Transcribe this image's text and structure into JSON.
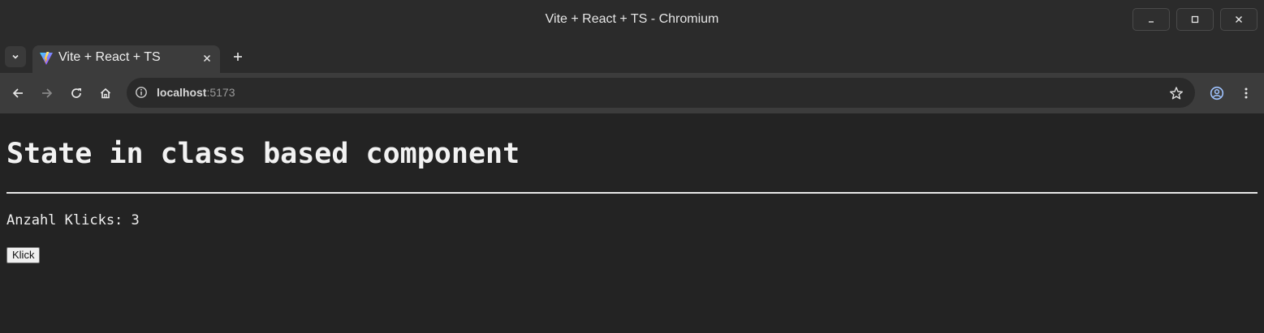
{
  "window": {
    "title": "Vite + React + TS - Chromium"
  },
  "tabs": [
    {
      "label": "Vite + React + TS",
      "favicon": "vite-logo"
    }
  ],
  "toolbar": {
    "url_host": "localhost",
    "url_port": ":5173"
  },
  "page": {
    "heading": "State in class based component",
    "counter_label": "Anzahl Klicks: ",
    "counter_value": "3",
    "button_label": "Klick"
  },
  "icons": {
    "tab_search": "chevron-down-icon",
    "tab_close": "close-icon",
    "new_tab": "plus-icon",
    "back": "arrow-left-icon",
    "forward": "arrow-right-icon",
    "reload": "reload-icon",
    "home": "home-icon",
    "site_info": "info-icon",
    "bookmark": "star-icon",
    "profile": "profile-icon",
    "menu": "kebab-menu-icon",
    "minimize": "minimize-icon",
    "maximize": "maximize-icon",
    "close": "close-icon"
  },
  "colors": {
    "page_background": "#232323",
    "titlebar": "#2b2b2b",
    "toolbar": "#3c3c3c",
    "omnibox": "#2a2a2a"
  }
}
